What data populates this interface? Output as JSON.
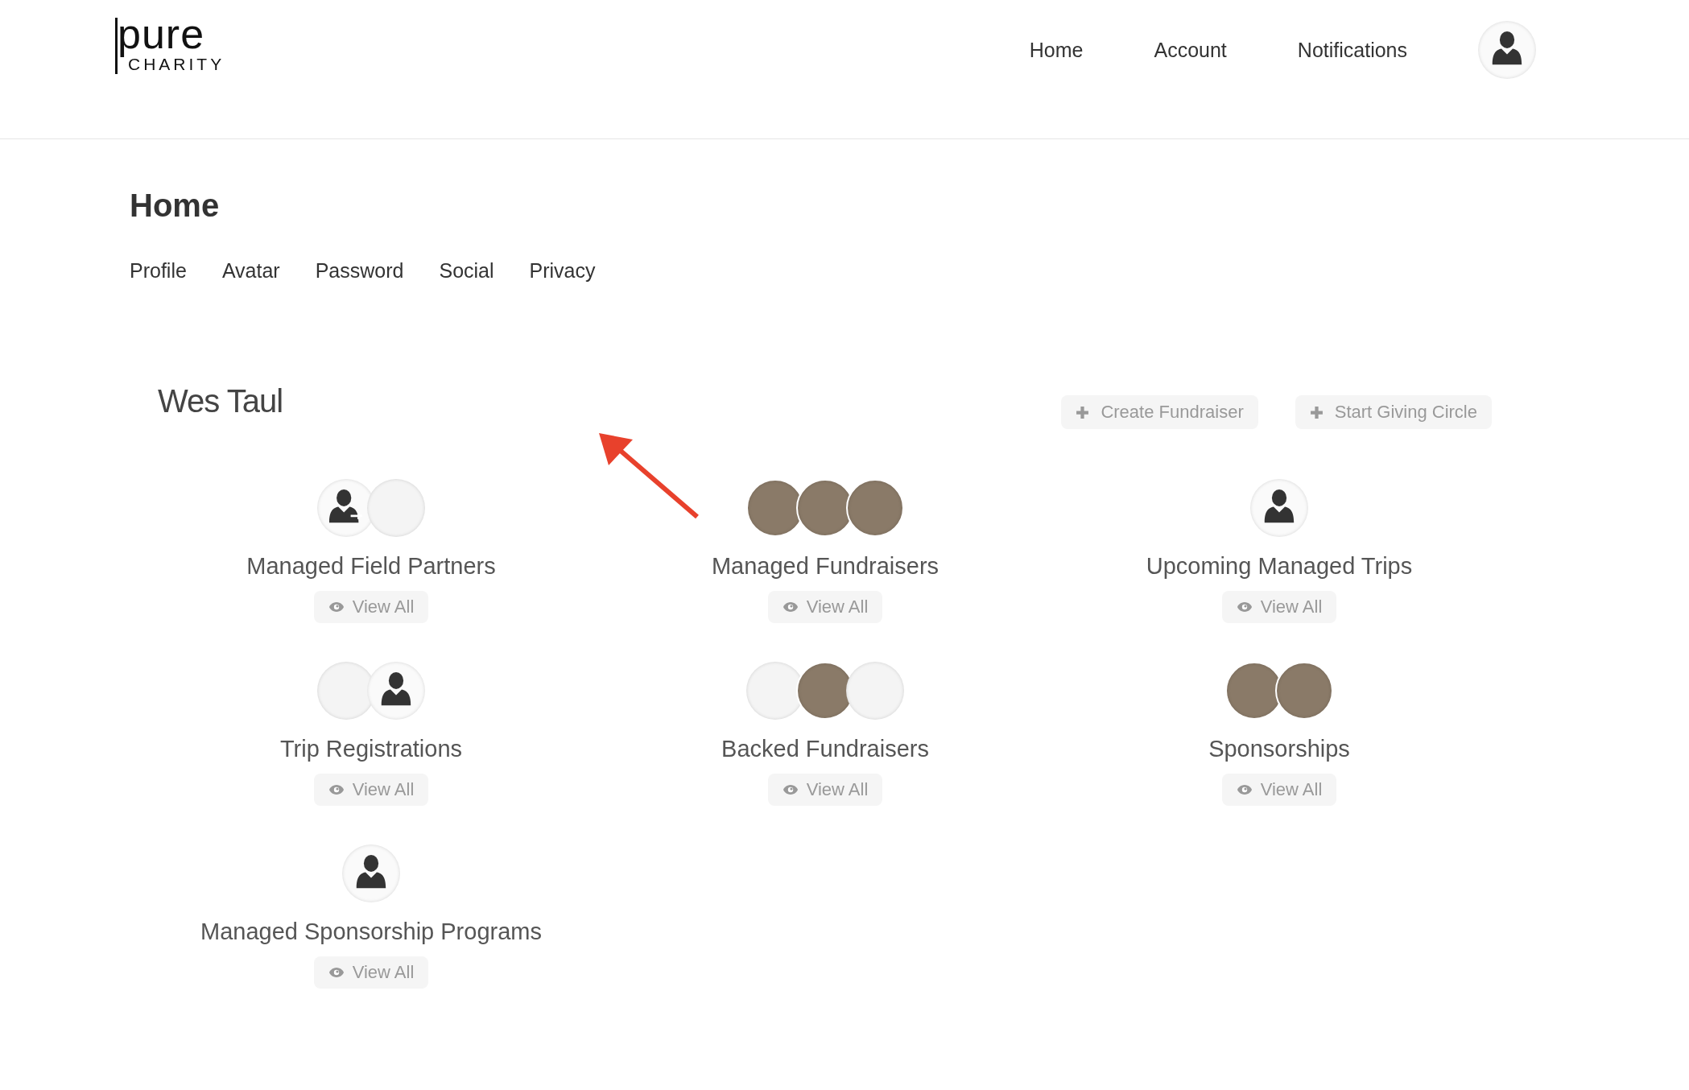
{
  "header": {
    "logo": {
      "word": "pure",
      "subword": "CHARITY"
    },
    "nav": [
      {
        "label": "Home"
      },
      {
        "label": "Account"
      },
      {
        "label": "Notifications"
      }
    ]
  },
  "page_title": "Home",
  "tabs": [
    {
      "label": "Profile"
    },
    {
      "label": "Avatar"
    },
    {
      "label": "Password"
    },
    {
      "label": "Social"
    },
    {
      "label": "Privacy"
    }
  ],
  "user_name": "Wes Taul",
  "actions": [
    {
      "label": "Create Fundraiser"
    },
    {
      "label": "Start Giving Circle"
    }
  ],
  "sections": [
    {
      "title": "Managed Field Partners",
      "button": "View All",
      "thumbnails": [
        {
          "kind": "medic"
        },
        {
          "kind": "logo"
        }
      ]
    },
    {
      "title": "Managed Fundraisers",
      "button": "View All",
      "thumbnails": [
        {
          "kind": "photo"
        },
        {
          "kind": "photo"
        },
        {
          "kind": "photo"
        }
      ]
    },
    {
      "title": "Upcoming Managed Trips",
      "button": "View All",
      "thumbnails": [
        {
          "kind": "avatar"
        }
      ]
    },
    {
      "title": "Trip Registrations",
      "button": "View All",
      "thumbnails": [
        {
          "kind": "logo"
        },
        {
          "kind": "avatar"
        }
      ]
    },
    {
      "title": "Backed Fundraisers",
      "button": "View All",
      "thumbnails": [
        {
          "kind": "logo"
        },
        {
          "kind": "photo"
        },
        {
          "kind": "logo"
        }
      ]
    },
    {
      "title": "Sponsorships",
      "button": "View All",
      "thumbnails": [
        {
          "kind": "photo"
        },
        {
          "kind": "photo"
        }
      ]
    },
    {
      "title": "Managed Sponsorship Programs",
      "button": "View All",
      "thumbnails": [
        {
          "kind": "avatar"
        }
      ]
    }
  ]
}
